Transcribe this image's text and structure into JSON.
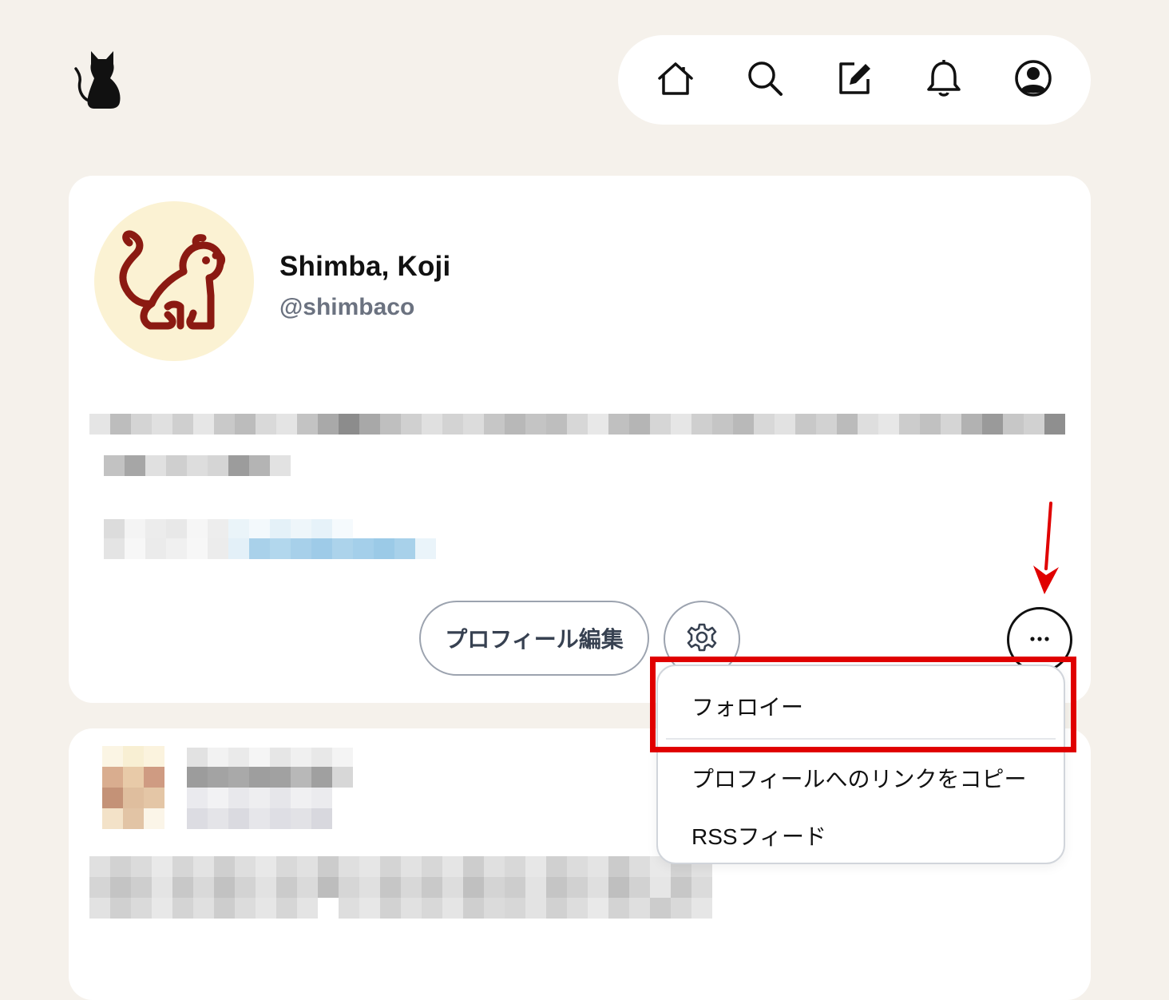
{
  "nav": {
    "logo_icon": "cat-icon",
    "items": [
      {
        "name": "home",
        "icon": "home-icon"
      },
      {
        "name": "search",
        "icon": "search-icon"
      },
      {
        "name": "compose",
        "icon": "compose-icon"
      },
      {
        "name": "notifications",
        "icon": "bell-icon"
      },
      {
        "name": "profile",
        "icon": "user-circle-icon"
      }
    ]
  },
  "profile": {
    "display_name": "Shimba, Koji",
    "handle": "@shimbaco",
    "avatar_icon": "lion-icon",
    "avatar_bg": "#fbf2d3",
    "avatar_fg": "#8b1a12",
    "edit_button_label": "プロフィール編集",
    "settings_icon": "gear-icon",
    "more_icon": "ellipsis-icon"
  },
  "menu": {
    "items": [
      {
        "label": "フォロイー"
      },
      {
        "label": "プロフィールへのリンクをコピー"
      },
      {
        "label": "RSSフィード"
      }
    ]
  },
  "annotation": {
    "color": "#e00000"
  }
}
